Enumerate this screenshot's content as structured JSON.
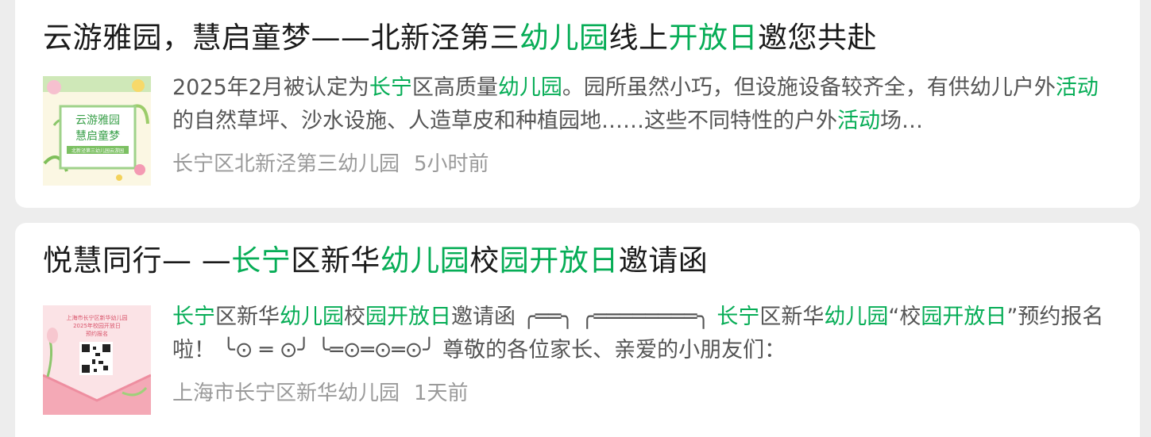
{
  "articles": [
    {
      "title_parts": [
        {
          "text": "云游雅园，慧启童梦——北新泾第三",
          "hl": false
        },
        {
          "text": "幼儿园",
          "hl": true
        },
        {
          "text": "线上",
          "hl": false
        },
        {
          "text": "开放日",
          "hl": true
        },
        {
          "text": "邀您共赴",
          "hl": false
        }
      ],
      "summary_parts": [
        {
          "text": "2025年2月被认定为",
          "hl": false
        },
        {
          "text": "长宁",
          "hl": true
        },
        {
          "text": "区高质量",
          "hl": false
        },
        {
          "text": "幼儿园",
          "hl": true
        },
        {
          "text": "。园所虽然小巧，但设施设备较齐全，有供幼儿户外",
          "hl": false
        },
        {
          "text": "活动",
          "hl": true
        },
        {
          "text": "的自然草坪、沙水设施、人造草皮和种植园地……这些不同特性的户外",
          "hl": false
        },
        {
          "text": "活动",
          "hl": true
        },
        {
          "text": "场…",
          "hl": false
        }
      ],
      "source": "长宁区北新泾第三幼儿园",
      "time": "5小时前",
      "thumbnail": {
        "line1": "云游雅园",
        "line2": "慧启童梦",
        "caption": "北新泾第三幼儿园云游园"
      }
    },
    {
      "title_parts": [
        {
          "text": "悦慧同行—  —",
          "hl": false
        },
        {
          "text": "长宁",
          "hl": true
        },
        {
          "text": "区新华",
          "hl": false
        },
        {
          "text": "幼儿园",
          "hl": true
        },
        {
          "text": "校",
          "hl": false
        },
        {
          "text": "园开放日",
          "hl": true
        },
        {
          "text": "邀请函",
          "hl": false
        }
      ],
      "summary_parts": [
        {
          "text": "长宁",
          "hl": true
        },
        {
          "text": "区新华",
          "hl": false
        },
        {
          "text": "幼儿园",
          "hl": true
        },
        {
          "text": "校",
          "hl": false
        },
        {
          "text": "园开放日",
          "hl": true
        },
        {
          "text": "邀请函 ╭══╮ ╭════════╮ ",
          "hl": false
        },
        {
          "text": "长宁",
          "hl": true
        },
        {
          "text": "区新华",
          "hl": false
        },
        {
          "text": "幼儿园",
          "hl": true
        },
        {
          "text": "“校",
          "hl": false
        },
        {
          "text": "园开放日",
          "hl": true
        },
        {
          "text": "”预约报名啦！ ╰⊙ ═ ⊙╯ ╰═⊙═⊙═⊙╯ 尊敬的各位家长、亲爱的小朋友们：",
          "hl": false
        }
      ],
      "source": "上海市长宁区新华幼儿园",
      "time": "1天前",
      "thumbnail": {
        "line1": "上海市长宁区新华幼儿园",
        "line2": "2025年校园开放日",
        "line3": "预约报名"
      }
    }
  ],
  "colors": {
    "highlight": "#06ad56",
    "title": "#1a1a1a",
    "summary": "#555555",
    "meta": "#9a9a9a"
  }
}
